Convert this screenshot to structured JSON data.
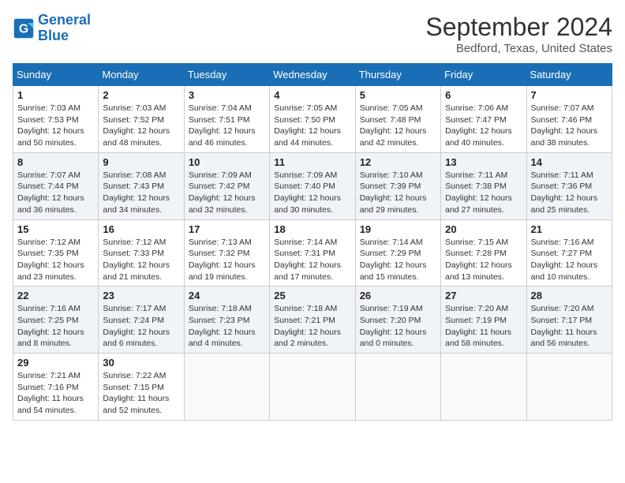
{
  "header": {
    "logo_line1": "General",
    "logo_line2": "Blue",
    "month_title": "September 2024",
    "subtitle": "Bedford, Texas, United States"
  },
  "weekdays": [
    "Sunday",
    "Monday",
    "Tuesday",
    "Wednesday",
    "Thursday",
    "Friday",
    "Saturday"
  ],
  "weeks": [
    [
      {
        "day": "1",
        "info": "Sunrise: 7:03 AM\nSunset: 7:53 PM\nDaylight: 12 hours\nand 50 minutes."
      },
      {
        "day": "2",
        "info": "Sunrise: 7:03 AM\nSunset: 7:52 PM\nDaylight: 12 hours\nand 48 minutes."
      },
      {
        "day": "3",
        "info": "Sunrise: 7:04 AM\nSunset: 7:51 PM\nDaylight: 12 hours\nand 46 minutes."
      },
      {
        "day": "4",
        "info": "Sunrise: 7:05 AM\nSunset: 7:50 PM\nDaylight: 12 hours\nand 44 minutes."
      },
      {
        "day": "5",
        "info": "Sunrise: 7:05 AM\nSunset: 7:48 PM\nDaylight: 12 hours\nand 42 minutes."
      },
      {
        "day": "6",
        "info": "Sunrise: 7:06 AM\nSunset: 7:47 PM\nDaylight: 12 hours\nand 40 minutes."
      },
      {
        "day": "7",
        "info": "Sunrise: 7:07 AM\nSunset: 7:46 PM\nDaylight: 12 hours\nand 38 minutes."
      }
    ],
    [
      {
        "day": "8",
        "info": "Sunrise: 7:07 AM\nSunset: 7:44 PM\nDaylight: 12 hours\nand 36 minutes."
      },
      {
        "day": "9",
        "info": "Sunrise: 7:08 AM\nSunset: 7:43 PM\nDaylight: 12 hours\nand 34 minutes."
      },
      {
        "day": "10",
        "info": "Sunrise: 7:09 AM\nSunset: 7:42 PM\nDaylight: 12 hours\nand 32 minutes."
      },
      {
        "day": "11",
        "info": "Sunrise: 7:09 AM\nSunset: 7:40 PM\nDaylight: 12 hours\nand 30 minutes."
      },
      {
        "day": "12",
        "info": "Sunrise: 7:10 AM\nSunset: 7:39 PM\nDaylight: 12 hours\nand 29 minutes."
      },
      {
        "day": "13",
        "info": "Sunrise: 7:11 AM\nSunset: 7:38 PM\nDaylight: 12 hours\nand 27 minutes."
      },
      {
        "day": "14",
        "info": "Sunrise: 7:11 AM\nSunset: 7:36 PM\nDaylight: 12 hours\nand 25 minutes."
      }
    ],
    [
      {
        "day": "15",
        "info": "Sunrise: 7:12 AM\nSunset: 7:35 PM\nDaylight: 12 hours\nand 23 minutes."
      },
      {
        "day": "16",
        "info": "Sunrise: 7:12 AM\nSunset: 7:33 PM\nDaylight: 12 hours\nand 21 minutes."
      },
      {
        "day": "17",
        "info": "Sunrise: 7:13 AM\nSunset: 7:32 PM\nDaylight: 12 hours\nand 19 minutes."
      },
      {
        "day": "18",
        "info": "Sunrise: 7:14 AM\nSunset: 7:31 PM\nDaylight: 12 hours\nand 17 minutes."
      },
      {
        "day": "19",
        "info": "Sunrise: 7:14 AM\nSunset: 7:29 PM\nDaylight: 12 hours\nand 15 minutes."
      },
      {
        "day": "20",
        "info": "Sunrise: 7:15 AM\nSunset: 7:28 PM\nDaylight: 12 hours\nand 13 minutes."
      },
      {
        "day": "21",
        "info": "Sunrise: 7:16 AM\nSunset: 7:27 PM\nDaylight: 12 hours\nand 10 minutes."
      }
    ],
    [
      {
        "day": "22",
        "info": "Sunrise: 7:16 AM\nSunset: 7:25 PM\nDaylight: 12 hours\nand 8 minutes."
      },
      {
        "day": "23",
        "info": "Sunrise: 7:17 AM\nSunset: 7:24 PM\nDaylight: 12 hours\nand 6 minutes."
      },
      {
        "day": "24",
        "info": "Sunrise: 7:18 AM\nSunset: 7:23 PM\nDaylight: 12 hours\nand 4 minutes."
      },
      {
        "day": "25",
        "info": "Sunrise: 7:18 AM\nSunset: 7:21 PM\nDaylight: 12 hours\nand 2 minutes."
      },
      {
        "day": "26",
        "info": "Sunrise: 7:19 AM\nSunset: 7:20 PM\nDaylight: 12 hours\nand 0 minutes."
      },
      {
        "day": "27",
        "info": "Sunrise: 7:20 AM\nSunset: 7:19 PM\nDaylight: 11 hours\nand 58 minutes."
      },
      {
        "day": "28",
        "info": "Sunrise: 7:20 AM\nSunset: 7:17 PM\nDaylight: 11 hours\nand 56 minutes."
      }
    ],
    [
      {
        "day": "29",
        "info": "Sunrise: 7:21 AM\nSunset: 7:16 PM\nDaylight: 11 hours\nand 54 minutes."
      },
      {
        "day": "30",
        "info": "Sunrise: 7:22 AM\nSunset: 7:15 PM\nDaylight: 11 hours\nand 52 minutes."
      },
      {
        "day": "",
        "info": ""
      },
      {
        "day": "",
        "info": ""
      },
      {
        "day": "",
        "info": ""
      },
      {
        "day": "",
        "info": ""
      },
      {
        "day": "",
        "info": ""
      }
    ]
  ]
}
